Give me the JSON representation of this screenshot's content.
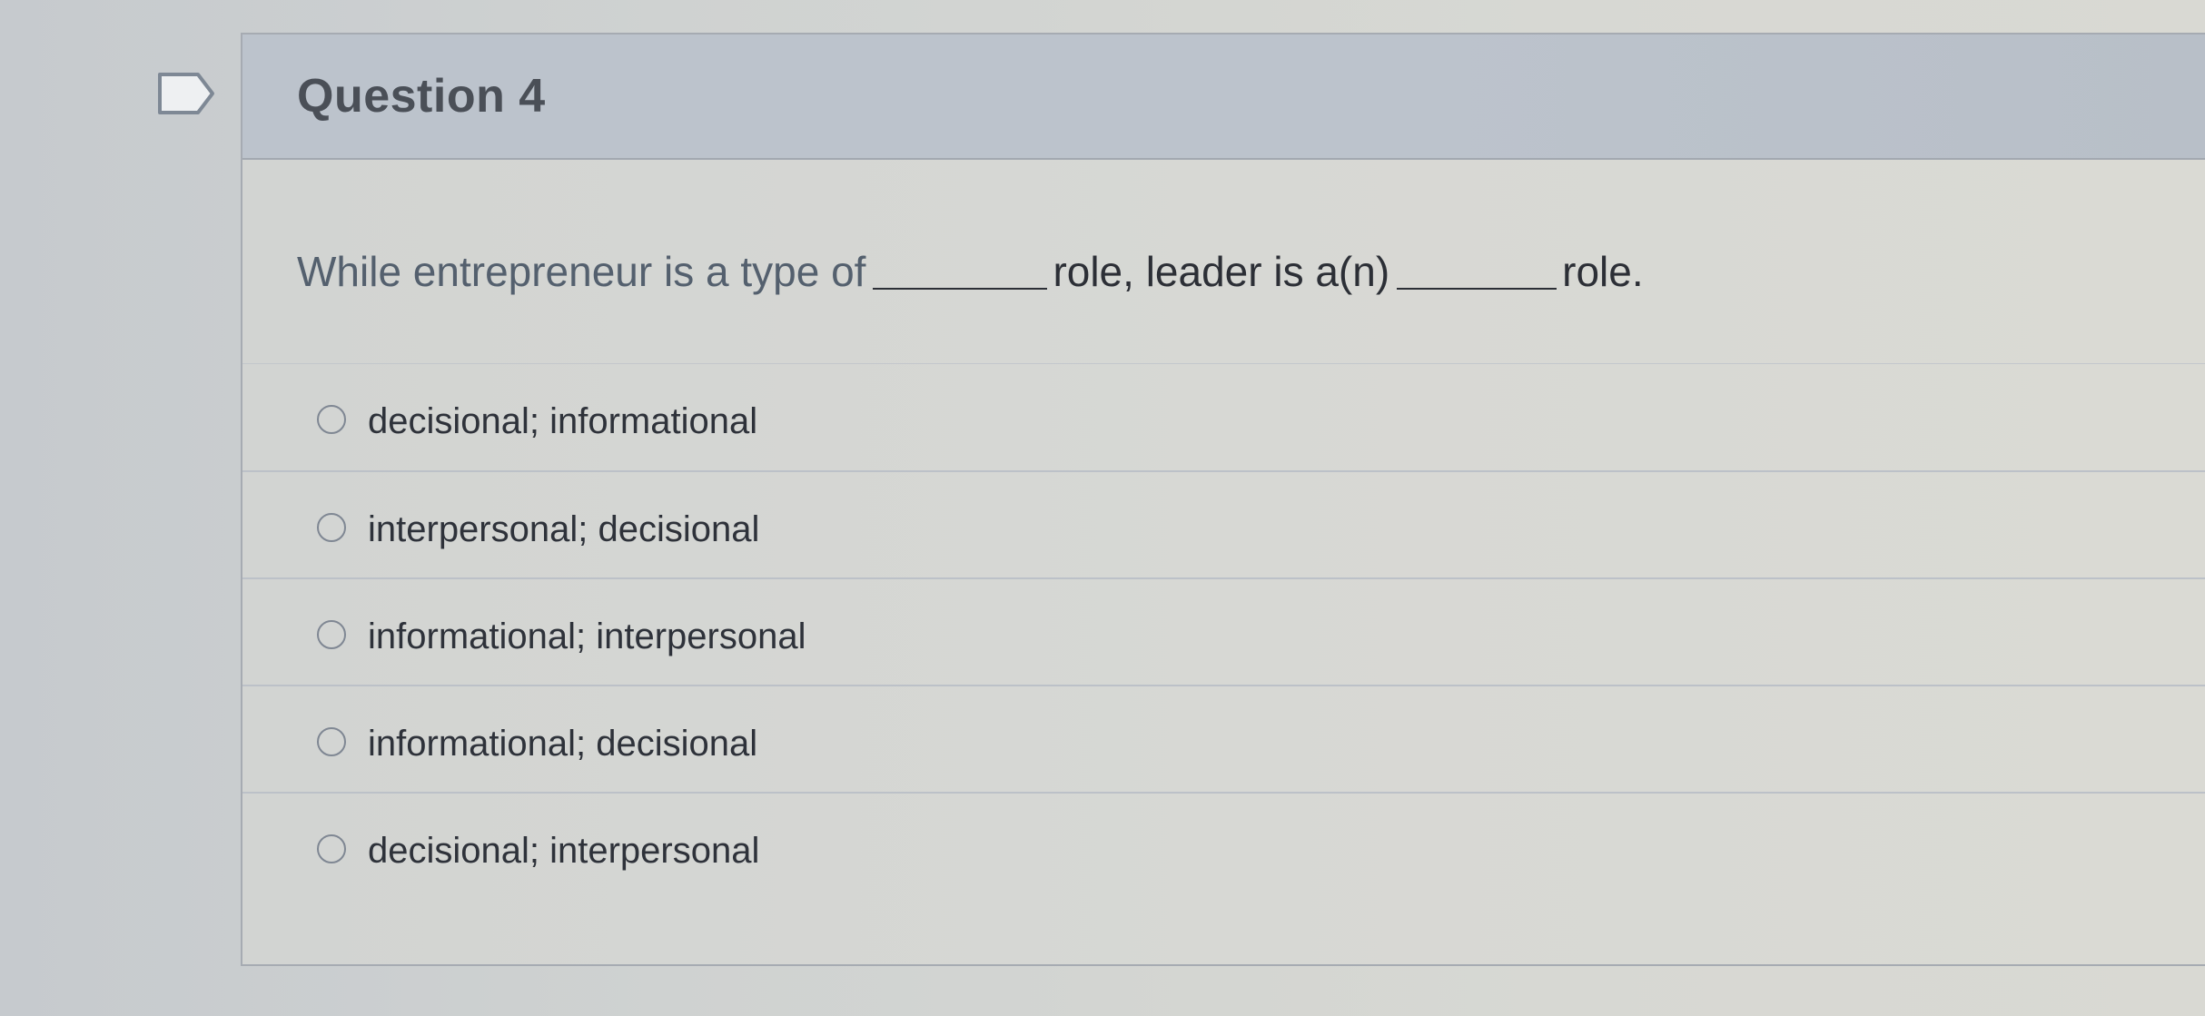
{
  "flag": {
    "icon": "flag-outline-icon"
  },
  "question": {
    "title": "Question 4",
    "text_part1": "While entrepreneur is a type of",
    "text_part2": "role, leader is a(n)",
    "text_part3": "role."
  },
  "options": [
    {
      "label": "decisional; informational",
      "selected": false
    },
    {
      "label": "interpersonal; decisional",
      "selected": false
    },
    {
      "label": "informational; interpersonal",
      "selected": false
    },
    {
      "label": "informational; decisional",
      "selected": false
    },
    {
      "label": "decisional; interpersonal",
      "selected": false
    }
  ],
  "colors": {
    "header_bg": "#bcc3cc",
    "card_bg": "#d7d8d4",
    "text": "#2c2f36",
    "radio_border": "#7f8793"
  }
}
